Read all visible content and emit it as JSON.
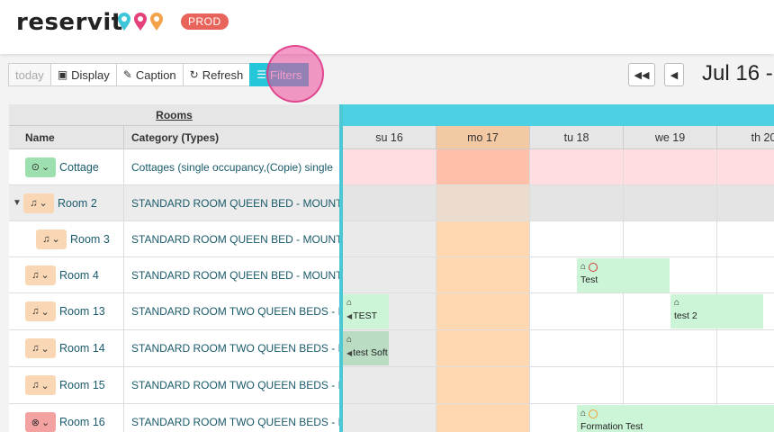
{
  "app": {
    "logo_text": "reservit",
    "env_badge": "PROD"
  },
  "toolbar": {
    "today_label": "today",
    "display_label": "Display",
    "caption_label": "Caption",
    "refresh_label": "Refresh",
    "filters_label": "Filters"
  },
  "nav": {
    "date_title": "Jul 16 -"
  },
  "rooms_panel": {
    "group_header": "Rooms",
    "col_name": "Name",
    "col_category": "Category (Types)",
    "rows": [
      {
        "name": "Cottage",
        "category": "Cottages (single occupancy,(Copie) single",
        "status": "clean"
      },
      {
        "name": "Room 2",
        "category": "STANDARD ROOM QUEEN BED - MOUNTAIN",
        "status": "dirty"
      },
      {
        "name": "Room 3",
        "category": "STANDARD ROOM QUEEN BED - MOUNTAIN",
        "status": "dirty"
      },
      {
        "name": "Room 4",
        "category": "STANDARD ROOM QUEEN BED - MOUNTAIN",
        "status": "dirty"
      },
      {
        "name": "Room 13",
        "category": "STANDARD ROOM TWO QUEEN BEDS - MOUNTAIN",
        "status": "dirty"
      },
      {
        "name": "Room 14",
        "category": "STANDARD ROOM TWO QUEEN BEDS - MOUNTAIN",
        "status": "dirty"
      },
      {
        "name": "Room 15",
        "category": "STANDARD ROOM TWO QUEEN BEDS - MOUNTAIN",
        "status": "dirty"
      },
      {
        "name": "Room 16",
        "category": "STANDARD ROOM TWO QUEEN BEDS - MOUNTAIN",
        "status": "out"
      }
    ]
  },
  "calendar": {
    "days": [
      "su 16",
      "mo 17",
      "tu 18",
      "we 19",
      "th 20"
    ],
    "bookings": [
      {
        "label": "Test",
        "room": "Room 4"
      },
      {
        "label": "TEST",
        "room": "Room 13"
      },
      {
        "label": "test 2",
        "room": "Room 13"
      },
      {
        "label": "test Soft",
        "room": "Room 14"
      },
      {
        "label": "Formation Test",
        "room": "Room 16"
      }
    ]
  },
  "colors": {
    "accent": "#26c6da",
    "today": "#f3c9a4",
    "booking": "#ccf5d7",
    "badge": "#e8645a"
  }
}
